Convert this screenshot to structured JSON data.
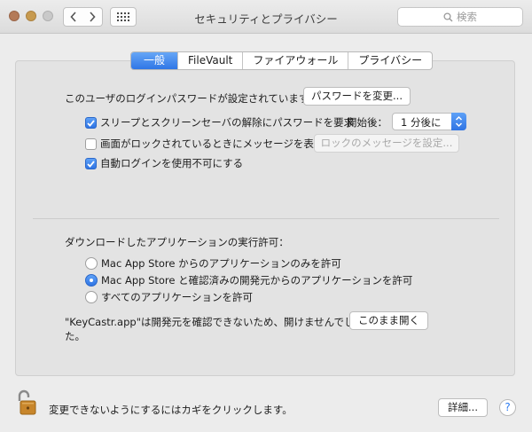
{
  "window": {
    "title": "セキュリティとプライバシー",
    "search_placeholder": "検索"
  },
  "tabs": [
    {
      "label": "一般",
      "active": true
    },
    {
      "label": "FileVault",
      "active": false
    },
    {
      "label": "ファイアウォール",
      "active": false
    },
    {
      "label": "プライバシー",
      "active": false
    }
  ],
  "general": {
    "password_label": "このユーザのログインパスワードが設定されています",
    "change_password_button": "パスワードを変更...",
    "require_password": {
      "label": "スリープとスクリーンセーバの解除にパスワードを要求",
      "checked": true
    },
    "delay_label": "開始後：",
    "delay_value": "1 分後に",
    "show_message": {
      "label": "画面がロックされているときにメッセージを表示",
      "checked": false
    },
    "set_message_button": "ロックのメッセージを設定...",
    "disable_auto_login": {
      "label": "自動ログインを使用不可にする",
      "checked": true
    }
  },
  "downloads": {
    "heading": "ダウンロードしたアプリケーションの実行許可：",
    "options": [
      {
        "label": "Mac App Store からのアプリケーションのみを許可",
        "selected": false
      },
      {
        "label": "Mac App Store と確認済みの開発元からのアプリケーションを許可",
        "selected": true
      },
      {
        "label": "すべてのアプリケーションを許可",
        "selected": false
      }
    ],
    "blocked_message_line1": "\"KeyCastr.app\"は開発元を確認できないため、開けませんでし",
    "blocked_message_line2": "た。",
    "open_anyway_button": "このまま開く"
  },
  "footer": {
    "lock_text": "変更できないようにするにはカギをクリックします。",
    "advanced_button": "詳細...",
    "help_button": "?"
  },
  "colors": {
    "accent": "#2f74e4",
    "lock": "#c8862b"
  }
}
